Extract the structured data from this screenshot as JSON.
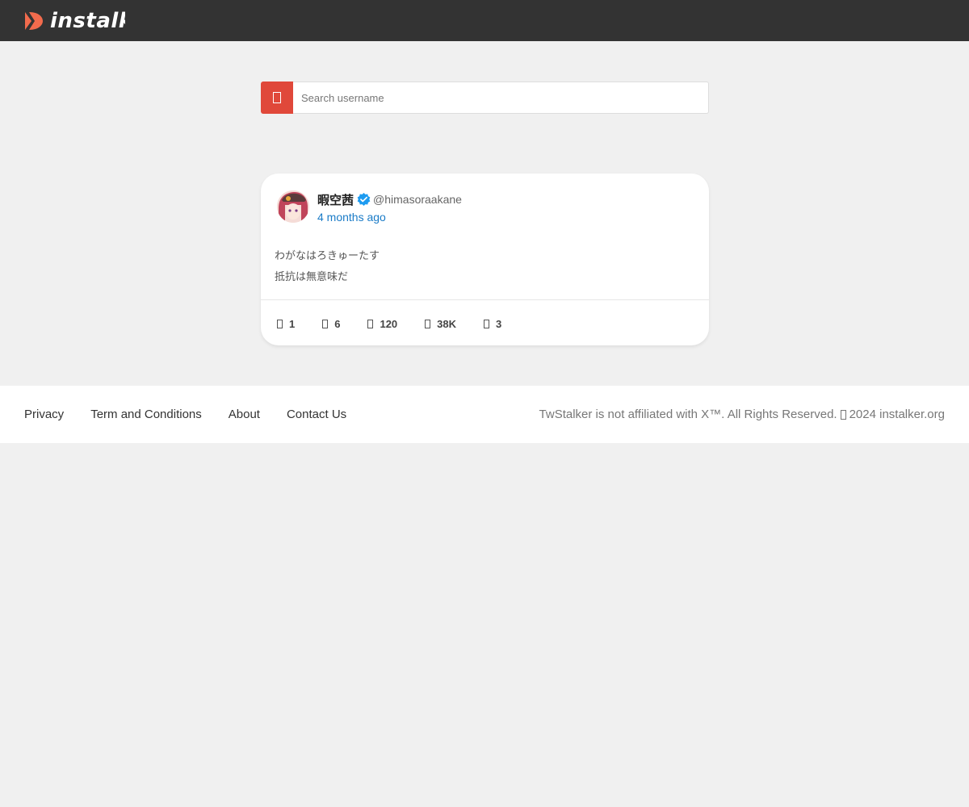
{
  "header": {
    "brand": "instalker",
    "brand_visible": "instalk",
    "brand_color": "#f26b4d",
    "bar_color": "#333333"
  },
  "search": {
    "placeholder": "Search username",
    "button_icon": "search-icon",
    "button_color": "#e0483a"
  },
  "tweet": {
    "display_name": "暇空茜",
    "verified": true,
    "handle": "@himasoraakane",
    "time": "4 months ago",
    "lines": [
      "わがなはろきゅーたす",
      "抵抗は無意味だ"
    ],
    "stats": [
      {
        "icon": "reply-icon",
        "value": "1"
      },
      {
        "icon": "retweet-icon",
        "value": "6"
      },
      {
        "icon": "like-icon",
        "value": "120"
      },
      {
        "icon": "views-icon",
        "value": "38K"
      },
      {
        "icon": "bookmark-icon",
        "value": "3"
      }
    ]
  },
  "footer": {
    "links": [
      "Privacy",
      "Term and Conditions",
      "About",
      "Contact Us"
    ],
    "notice": "TwStalker is not affiliated with X™. All Rights Reserved.",
    "copyright": "2024 instalker.org"
  }
}
